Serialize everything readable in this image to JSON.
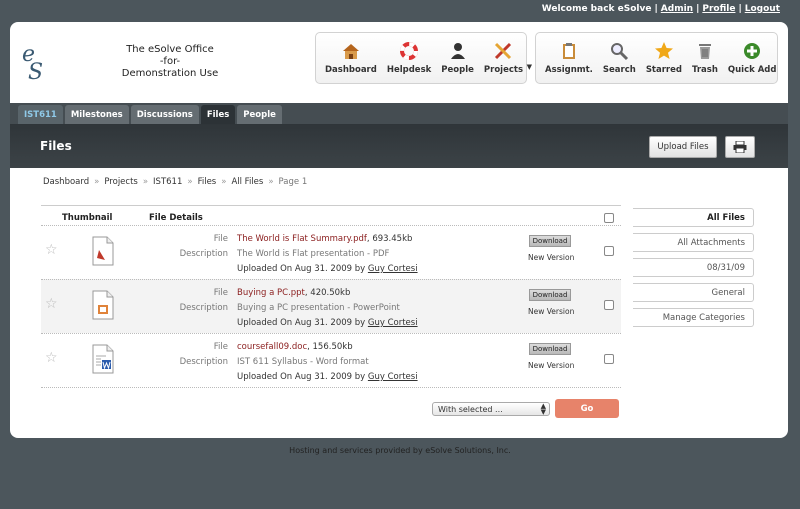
{
  "topbar": {
    "welcome": "Welcome back eSolve",
    "links": [
      "Admin",
      "Profile",
      "Logout"
    ]
  },
  "brand": {
    "logo_text_top": "e",
    "logo_text_bottom": "S",
    "line1": "The eSolve Office",
    "line2": "-for-",
    "line3": "Demonstration Use"
  },
  "toolbar_primary": [
    {
      "label": "Dashboard",
      "icon": "house-icon"
    },
    {
      "label": "Helpdesk",
      "icon": "lifebuoy-icon"
    },
    {
      "label": "People",
      "icon": "people-icon"
    },
    {
      "label": "Projects",
      "icon": "tools-icon"
    }
  ],
  "toolbar_secondary": [
    {
      "label": "Assignmt.",
      "icon": "clipboard-icon"
    },
    {
      "label": "Search",
      "icon": "magnifier-icon"
    },
    {
      "label": "Starred",
      "icon": "star-icon"
    },
    {
      "label": "Trash",
      "icon": "trash-icon"
    },
    {
      "label": "Quick Add",
      "icon": "plus-icon"
    }
  ],
  "tabs": [
    "IST611",
    "Milestones",
    "Discussions",
    "Files",
    "People"
  ],
  "page": {
    "title": "Files",
    "upload_label": "Upload Files"
  },
  "breadcrumb": [
    "Dashboard",
    "Projects",
    "IST611",
    "Files",
    "All Files",
    "Page 1"
  ],
  "table": {
    "col_thumbnail": "Thumbnail",
    "col_details": "File Details",
    "label_file": "File",
    "label_description": "Description",
    "download_label": "Download",
    "new_version_label": "New Version",
    "rows": [
      {
        "file_name": "The World is Flat Summary.pdf",
        "file_size": ", 693.45kb",
        "description": "The World is Flat presentation - PDF",
        "uploaded": "Uploaded On Aug 31. 2009 by ",
        "author": "Guy Cortesi",
        "type": "pdf"
      },
      {
        "file_name": "Buying a PC.ppt",
        "file_size": ", 420.50kb",
        "description": "Buying a PC presentation - PowerPoint",
        "uploaded": "Uploaded On Aug 31. 2009 by ",
        "author": "Guy Cortesi",
        "type": "ppt"
      },
      {
        "file_name": "coursefall09.doc",
        "file_size": ", 156.50kb",
        "description": "IST 611 Syllabus - Word format",
        "uploaded": "Uploaded On Aug 31. 2009 by ",
        "author": "Guy Cortesi",
        "type": "doc"
      }
    ]
  },
  "bulk": {
    "select_value": "With selected ...",
    "go_label": "Go"
  },
  "sidebar": [
    "All Files",
    "All Attachments",
    "08/31/09",
    "General",
    "Manage Categories"
  ],
  "footer": "Hosting and services provided by eSolve Solutions, Inc.",
  "colors": {
    "background": "#4c565c",
    "file_link": "#8a1d1d",
    "go_button": "#e7836a",
    "course_tab": "#8fc9e8"
  }
}
